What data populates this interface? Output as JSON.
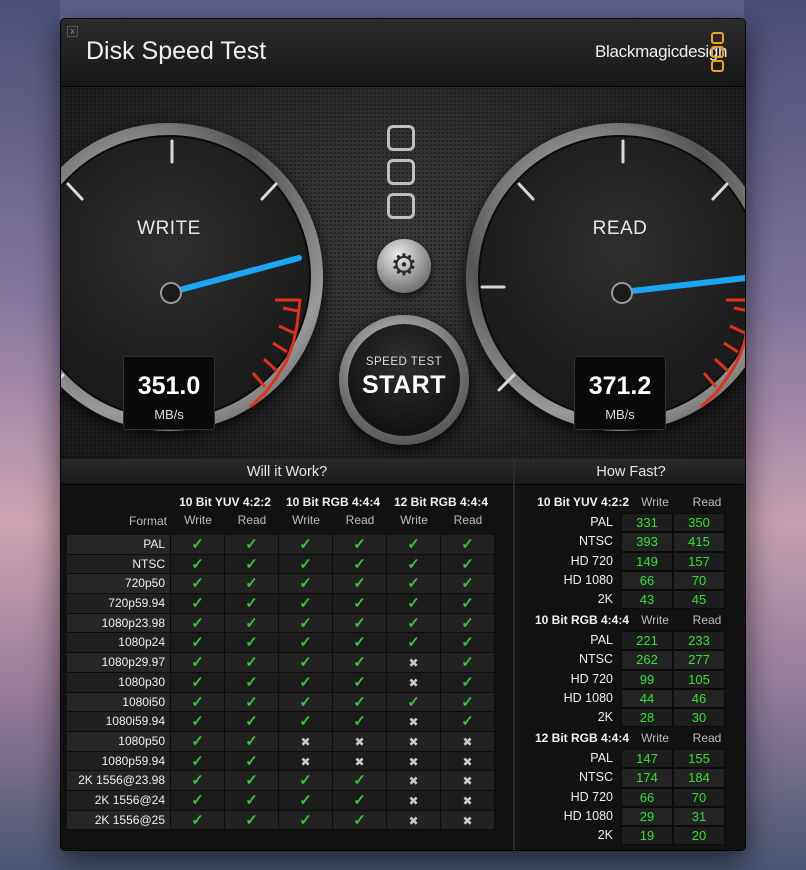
{
  "app": {
    "title": "Disk Speed Test",
    "brand": "Blackmagicdesign",
    "close_glyph": "x"
  },
  "write_gauge": {
    "label": "WRITE",
    "value": "351.0",
    "unit": "MB/s"
  },
  "read_gauge": {
    "label": "READ",
    "value": "371.2",
    "unit": "MB/s"
  },
  "start_button": {
    "line1": "SPEED TEST",
    "line2": "START"
  },
  "settings_icon": "gear-icon",
  "will_it_work": {
    "title": "Will it Work?",
    "format_header": "Format",
    "groups": [
      "10 Bit YUV 4:2:2",
      "10 Bit RGB 4:4:4",
      "12 Bit RGB 4:4:4"
    ],
    "sub": {
      "write": "Write",
      "read": "Read"
    },
    "rows": [
      {
        "format": "PAL",
        "cells": [
          "ok",
          "ok",
          "ok",
          "ok",
          "ok",
          "ok"
        ]
      },
      {
        "format": "NTSC",
        "cells": [
          "ok",
          "ok",
          "ok",
          "ok",
          "ok",
          "ok"
        ]
      },
      {
        "format": "720p50",
        "cells": [
          "ok",
          "ok",
          "ok",
          "ok",
          "ok",
          "ok"
        ]
      },
      {
        "format": "720p59.94",
        "cells": [
          "ok",
          "ok",
          "ok",
          "ok",
          "ok",
          "ok"
        ]
      },
      {
        "format": "1080p23.98",
        "cells": [
          "ok",
          "ok",
          "ok",
          "ok",
          "ok",
          "ok"
        ]
      },
      {
        "format": "1080p24",
        "cells": [
          "ok",
          "ok",
          "ok",
          "ok",
          "ok",
          "ok"
        ]
      },
      {
        "format": "1080p29.97",
        "cells": [
          "ok",
          "ok",
          "ok",
          "ok",
          "no",
          "ok"
        ]
      },
      {
        "format": "1080p30",
        "cells": [
          "ok",
          "ok",
          "ok",
          "ok",
          "no",
          "ok"
        ]
      },
      {
        "format": "1080i50",
        "cells": [
          "ok",
          "ok",
          "ok",
          "ok",
          "ok",
          "ok"
        ]
      },
      {
        "format": "1080i59.94",
        "cells": [
          "ok",
          "ok",
          "ok",
          "ok",
          "no",
          "ok"
        ]
      },
      {
        "format": "1080p50",
        "cells": [
          "ok",
          "ok",
          "no",
          "no",
          "no",
          "no"
        ]
      },
      {
        "format": "1080p59.94",
        "cells": [
          "ok",
          "ok",
          "no",
          "no",
          "no",
          "no"
        ]
      },
      {
        "format": "2K 1556@23.98",
        "cells": [
          "ok",
          "ok",
          "ok",
          "ok",
          "no",
          "no"
        ]
      },
      {
        "format": "2K 1556@24",
        "cells": [
          "ok",
          "ok",
          "ok",
          "ok",
          "no",
          "no"
        ]
      },
      {
        "format": "2K 1556@25",
        "cells": [
          "ok",
          "ok",
          "ok",
          "ok",
          "no",
          "no"
        ]
      }
    ]
  },
  "how_fast": {
    "title": "How Fast?",
    "groups": [
      {
        "name": "10 Bit YUV 4:2:2",
        "write_label": "Write",
        "read_label": "Read",
        "rows": [
          {
            "label": "PAL",
            "write": "331",
            "read": "350"
          },
          {
            "label": "NTSC",
            "write": "393",
            "read": "415"
          },
          {
            "label": "HD 720",
            "write": "149",
            "read": "157"
          },
          {
            "label": "HD 1080",
            "write": "66",
            "read": "70"
          },
          {
            "label": "2K",
            "write": "43",
            "read": "45"
          }
        ]
      },
      {
        "name": "10 Bit RGB 4:4:4",
        "write_label": "Write",
        "read_label": "Read",
        "rows": [
          {
            "label": "PAL",
            "write": "221",
            "read": "233"
          },
          {
            "label": "NTSC",
            "write": "262",
            "read": "277"
          },
          {
            "label": "HD 720",
            "write": "99",
            "read": "105"
          },
          {
            "label": "HD 1080",
            "write": "44",
            "read": "46"
          },
          {
            "label": "2K",
            "write": "28",
            "read": "30"
          }
        ]
      },
      {
        "name": "12 Bit RGB 4:4:4",
        "write_label": "Write",
        "read_label": "Read",
        "rows": [
          {
            "label": "PAL",
            "write": "147",
            "read": "155"
          },
          {
            "label": "NTSC",
            "write": "174",
            "read": "184"
          },
          {
            "label": "HD 720",
            "write": "66",
            "read": "70"
          },
          {
            "label": "HD 1080",
            "write": "29",
            "read": "31"
          },
          {
            "label": "2K",
            "write": "19",
            "read": "20"
          }
        ]
      }
    ]
  },
  "colors": {
    "needle": "#1aa6f2",
    "check": "#39c23c",
    "speed_value": "#34e034",
    "redline": "#e0311a",
    "logo": "#f0a020"
  }
}
